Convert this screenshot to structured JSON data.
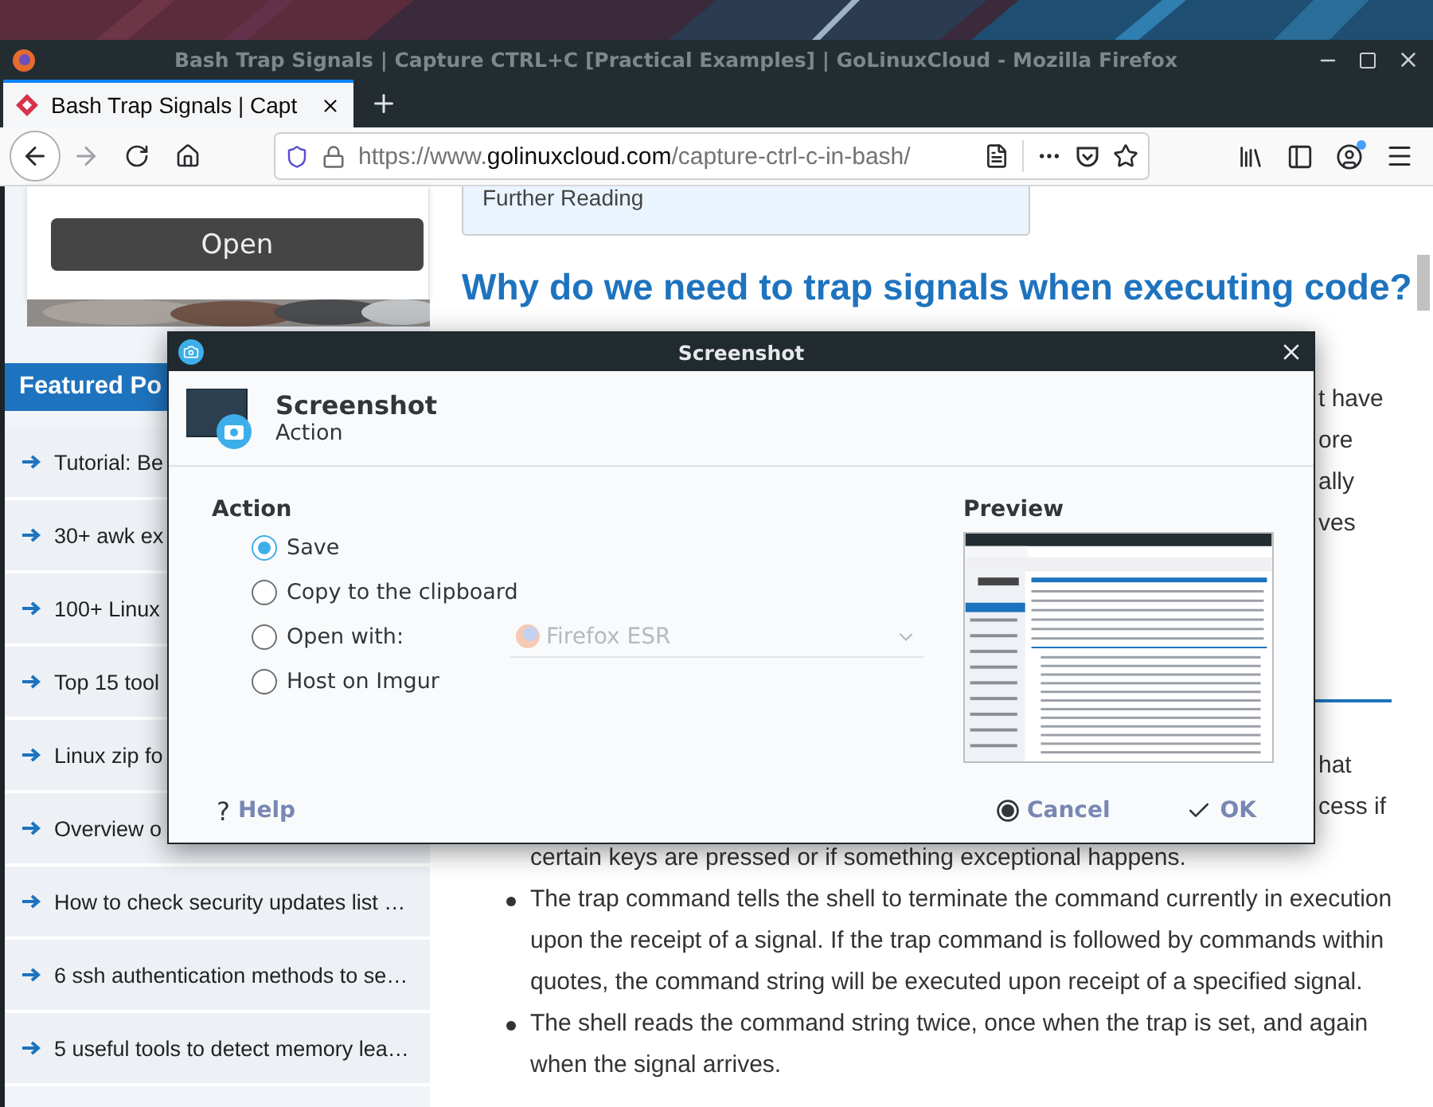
{
  "browser": {
    "title": "Bash Trap Signals | Capture CTRL+C [Practical Examples] | GoLinuxCloud - Mozilla Firefox",
    "tabs": [
      {
        "label": "Bash Trap Signals | Capt",
        "selected": true
      }
    ],
    "url": {
      "prefix": "https://www.",
      "domain": "golinuxcloud.com",
      "path": "/capture-ctrl-c-in-bash/"
    }
  },
  "page": {
    "sidebar": {
      "button": "Open",
      "featured_title": "Featured Po",
      "items": [
        "Tutorial: Be",
        "30+ awk ex",
        "100+ Linux",
        "Top 15 tool",
        "Linux zip fo",
        "Overview o",
        "How to check security updates list …",
        "6 ssh authentication methods to se…",
        "5 useful tools to detect memory lea…"
      ]
    },
    "article": {
      "box_text": "Further Reading",
      "heading": "Why do we need to trap signals when executing code?",
      "fragments_top": [
        "t have",
        "ore",
        "ally",
        "ves"
      ],
      "fragments_bottom": [
        "hat",
        "cess if"
      ],
      "continued_line": "certain keys are pressed or if something exceptional happens.",
      "bullets": [
        "The trap command tells the shell to terminate the command currently in execution upon the receipt of a signal. If the trap command is followed by commands within quotes, the command string will be executed upon receipt of a specified signal.",
        "The shell reads the command string twice, once when the trap is set, and again when the signal arrives."
      ]
    }
  },
  "dialog": {
    "title": "Screenshot",
    "header_title": "Screenshot",
    "header_subtitle": "Action",
    "action_label": "Action",
    "options": [
      {
        "label": "Save",
        "selected": true
      },
      {
        "label": "Copy to the clipboard",
        "selected": false
      },
      {
        "label": "Open with:",
        "selected": false
      },
      {
        "label": "Host on Imgur",
        "selected": false
      }
    ],
    "open_with": {
      "value": "Firefox ESR",
      "disabled": true
    },
    "preview_label": "Preview",
    "buttons": [
      {
        "kind": "help",
        "symbol": "?",
        "label": "Help"
      },
      {
        "kind": "cancel",
        "label": "Cancel"
      },
      {
        "kind": "ok",
        "label": "OK"
      }
    ]
  }
}
